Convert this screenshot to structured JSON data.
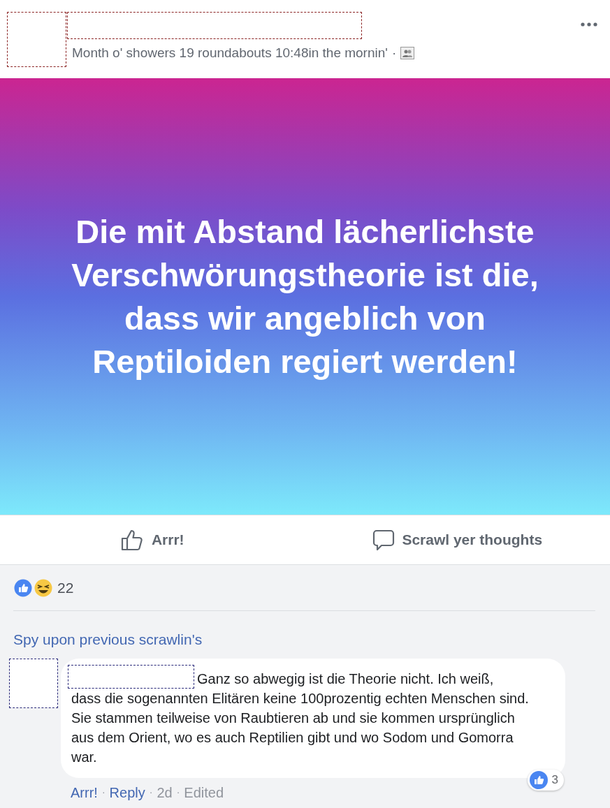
{
  "post": {
    "timestamp": "Month o' showers 19 roundabouts 10:48in the mornin'",
    "separator": "·",
    "text": "Die mit Abstand lächerlichste Verschwörungstheorie ist die, dass wir angeblich von Reptiloiden regiert werden!"
  },
  "actions": [
    {
      "kind": "like",
      "label": "Arrr!"
    },
    {
      "kind": "comment",
      "label": "Scrawl yer thoughts"
    }
  ],
  "reactions": {
    "count": "22"
  },
  "previous_comments_link": "Spy upon previous scrawlin's",
  "comment": {
    "text_first_line": "Ganz so abwegig ist die Theorie nicht. Ich weiß,",
    "text": "dass die sogenannten Elitären keine 100prozentig echten Menschen sind. Sie stammen teilweise von Raubtieren ab und sie kommen ursprünglich aus dem Orient, wo es auch Reptilien gibt und wo Sodom und Gomorra war.",
    "reaction_count": "3",
    "link_separator": "·",
    "links": [
      {
        "kind": "link",
        "label": "Arrr!"
      },
      {
        "kind": "link",
        "label": "Reply"
      },
      {
        "kind": "meta",
        "label": "2d"
      },
      {
        "kind": "meta",
        "label": "Edited"
      }
    ]
  }
}
